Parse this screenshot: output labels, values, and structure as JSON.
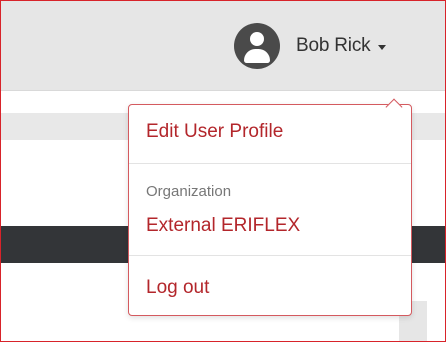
{
  "header": {
    "user_name": "Bob Rick",
    "avatar_icon": "user-avatar-icon",
    "caret_icon": "caret-down-icon"
  },
  "user_menu": {
    "edit_profile_label": "Edit User Profile",
    "organization_heading": "Organization",
    "organization_name": "External ERIFLEX",
    "logout_label": "Log out"
  },
  "colors": {
    "accent": "#b3262b",
    "frame_border": "#d8232a",
    "avatar": "#4a4a4a",
    "dark_strip": "#333538"
  }
}
